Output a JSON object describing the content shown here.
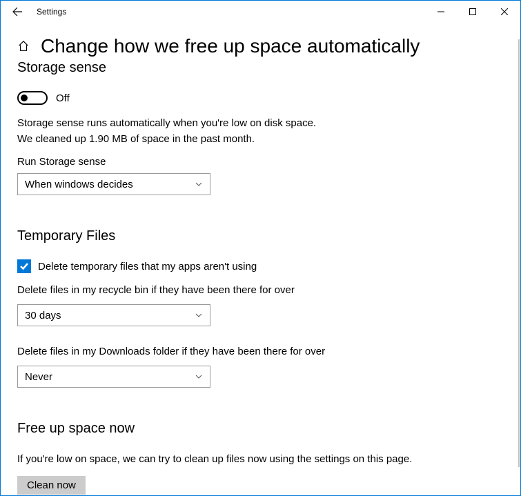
{
  "window": {
    "title": "Settings"
  },
  "page": {
    "title": "Change how we free up space automatically"
  },
  "storage_sense": {
    "heading": "Storage sense",
    "toggle_state": "Off",
    "info_line1": "Storage sense runs automatically when you're low on disk space.",
    "info_line2": "We cleaned up 1.90 MB of space in the past month.",
    "run_label": "Run Storage sense",
    "run_value": "When windows decides"
  },
  "temp_files": {
    "heading": "Temporary Files",
    "checkbox_label": "Delete temporary files that my apps aren't using",
    "recycle_label": "Delete files in my recycle bin if they have been there for over",
    "recycle_value": "30 days",
    "downloads_label": "Delete files in my Downloads folder if they have been there for over",
    "downloads_value": "Never"
  },
  "free_up": {
    "heading": "Free up space now",
    "paragraph": "If you're low on space, we can try to clean up files now using the settings on this page.",
    "button": "Clean now"
  }
}
